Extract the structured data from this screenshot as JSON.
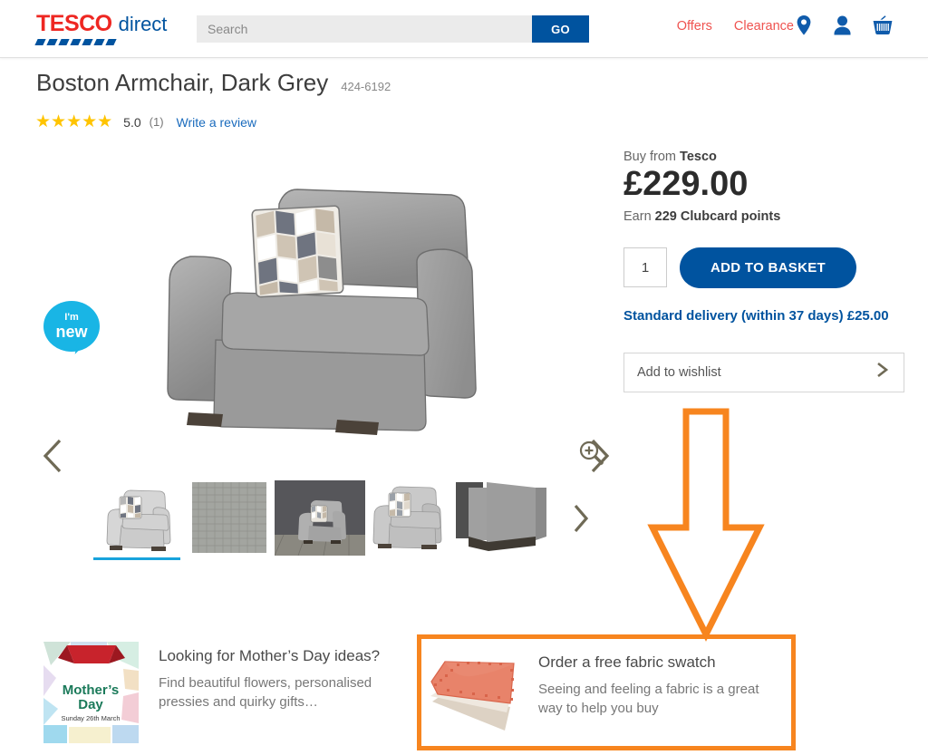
{
  "header": {
    "logo": {
      "brand": "TESCO",
      "suffix": "direct"
    },
    "search": {
      "placeholder": "Search",
      "value": "",
      "go_label": "GO"
    },
    "links": [
      {
        "label": "Offers",
        "name": "offers-link"
      },
      {
        "label": "Clearance",
        "name": "clearance-link"
      }
    ],
    "icons": [
      {
        "name": "location-pin-icon"
      },
      {
        "name": "account-person-icon"
      },
      {
        "name": "shopping-basket-icon"
      }
    ],
    "colors": {
      "brand_red": "#ee2722",
      "brand_blue": "#00539f",
      "link_red": "#ef5350"
    }
  },
  "product": {
    "title": "Boston Armchair, Dark Grey",
    "sku": "424-6192",
    "rating": {
      "stars": "★★★★★",
      "value": "5.0",
      "count": "(1)",
      "write_review": "Write a review"
    },
    "badge": {
      "line1": "I'm",
      "line2": "new",
      "color": "#19b5e5"
    }
  },
  "gallery": {
    "prev_label": "Previous image",
    "next_label": "Next image",
    "zoom_label": "Zoom image",
    "thumbs_next_label": "More images",
    "thumbnails": [
      {
        "alt": "Armchair front view",
        "selected": true
      },
      {
        "alt": "Fabric close-up swatch",
        "selected": false
      },
      {
        "alt": "Armchair in room setting",
        "selected": false
      },
      {
        "alt": "Armchair angled view",
        "selected": false
      },
      {
        "alt": "Armchair base and leg detail",
        "selected": false
      }
    ]
  },
  "buybox": {
    "buy_from_prefix": "Buy from ",
    "buy_from_seller": "Tesco",
    "price": "£229.00",
    "clubcard_prefix": "Earn ",
    "clubcard_points": "229 Clubcard points",
    "quantity": "1",
    "add_to_basket": "ADD TO BASKET",
    "delivery": "Standard delivery (within 37 days) £25.00",
    "wishlist": "Add to wishlist"
  },
  "annotation": {
    "arrow_color": "#f7851f",
    "arrow_direction": "down",
    "points_to": "Order a free fabric swatch"
  },
  "promos": {
    "mothers_day": {
      "image_title_1": "Mother's",
      "image_title_2": "Day",
      "image_date": "Sunday 26th March",
      "title": "Looking for Mother’s Day ideas?",
      "subtitle": "Find beautiful flowers, personalised pressies and quirky gifts…"
    },
    "fabric_swatch": {
      "title": "Order a free fabric swatch",
      "subtitle": "Seeing and feeling a fabric is a great way to help you buy",
      "highlight_color": "#f7851f"
    }
  }
}
